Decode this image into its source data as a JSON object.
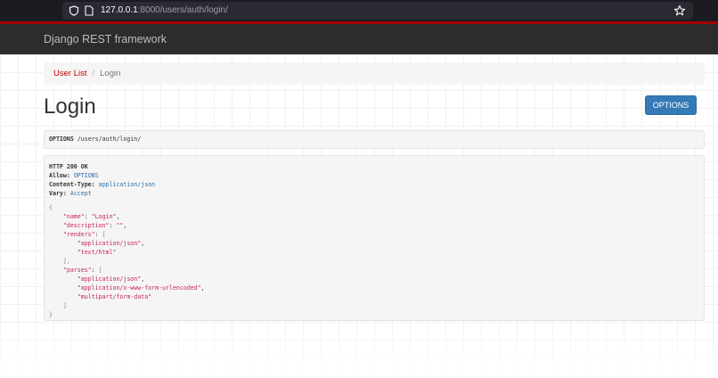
{
  "browser": {
    "url_host": "127.0.0.1",
    "url_rest": ":8000/users/auth/login/"
  },
  "navbar": {
    "brand": "Django REST framework"
  },
  "breadcrumb": {
    "link_label": "User List",
    "separator": "/",
    "current": "Login"
  },
  "page": {
    "title": "Login",
    "options_button": "OPTIONS"
  },
  "request": {
    "method": "OPTIONS",
    "path": "/users/auth/login/"
  },
  "response": {
    "status": "HTTP 200 OK",
    "headers": [
      {
        "key": "Allow:",
        "value": "OPTIONS"
      },
      {
        "key": "Content-Type:",
        "value": "application/json"
      },
      {
        "key": "Vary:",
        "value": "Accept"
      }
    ],
    "body": {
      "name_key": "\"name\"",
      "name_value": "\"Login\"",
      "description_key": "\"description\"",
      "description_value": "\"\"",
      "renders_key": "\"renders\"",
      "renders": [
        "\"application/json\"",
        "\"text/html\""
      ],
      "parses_key": "\"parses\"",
      "parses": [
        "\"application/json\"",
        "\"application/x-www-form-urlencoded\"",
        "\"multipart/form-data\""
      ]
    }
  },
  "colors": {
    "navbar_bg": "#2c2c2c",
    "navbar_accent": "#a30000",
    "link_red": "#c20000",
    "button_blue": "#337ab7",
    "json_string": "#c7254e",
    "header_value": "#2f6fab"
  },
  "icons": [
    "shield-icon",
    "page-icon",
    "bookmark-star-icon"
  ]
}
